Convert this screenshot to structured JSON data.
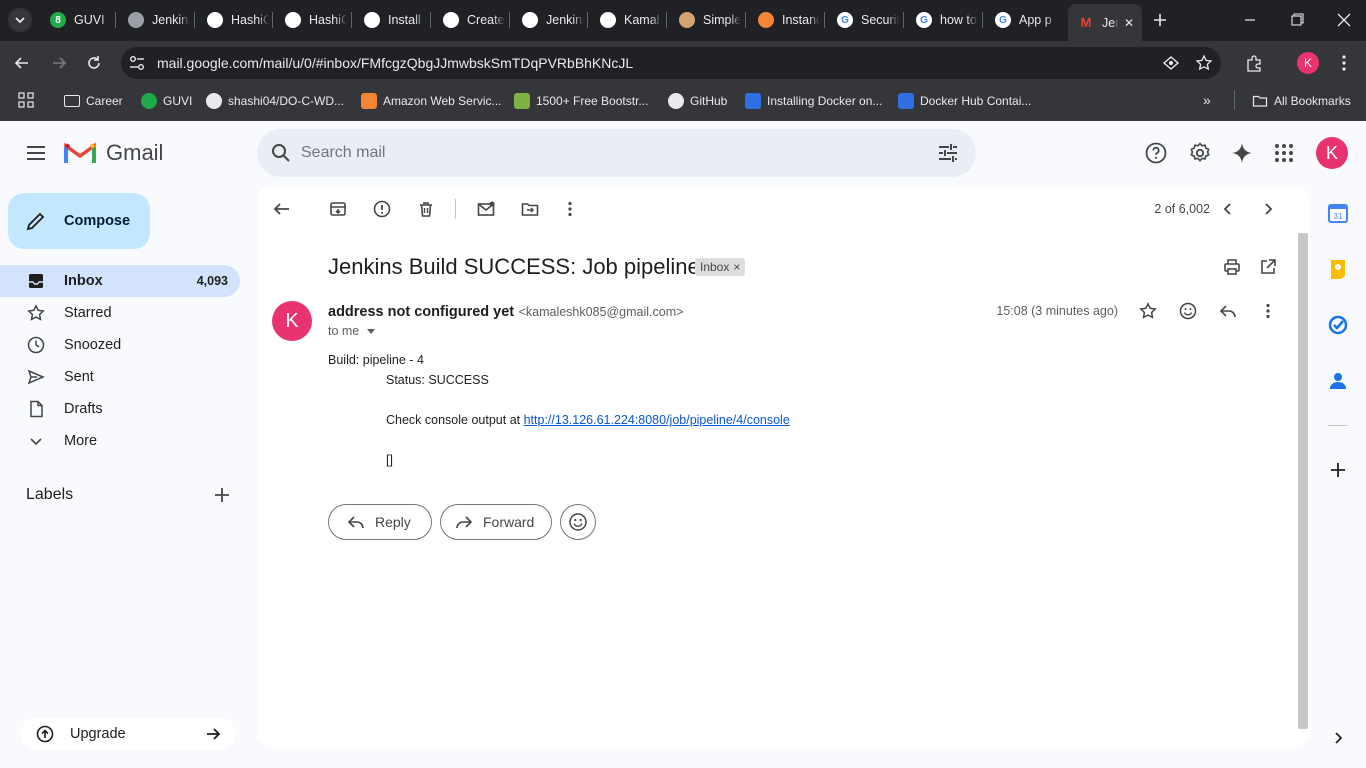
{
  "browser": {
    "tabs": [
      {
        "title": "GUVI",
        "favicon": "guvi-icon",
        "color": "#1faa4b",
        "glyph": "8"
      },
      {
        "title": "Jenkins",
        "favicon": "jenkins-icon",
        "color": "#9aa0a6",
        "glyph": ""
      },
      {
        "title": "HashiCorp",
        "favicon": "hashicorp-icon",
        "color": "#ffffff",
        "glyph": ""
      },
      {
        "title": "HashiCorp",
        "favicon": "hashicorp-icon",
        "color": "#ffffff",
        "glyph": ""
      },
      {
        "title": "Install",
        "favicon": "hashicorp-icon",
        "color": "#ffffff",
        "glyph": ""
      },
      {
        "title": "Create",
        "favicon": "hashicorp-icon",
        "color": "#ffffff",
        "glyph": ""
      },
      {
        "title": "Jenkins",
        "favicon": "github-icon",
        "color": "#ffffff",
        "glyph": ""
      },
      {
        "title": "Kamal",
        "favicon": "github-icon",
        "color": "#ffffff",
        "glyph": ""
      },
      {
        "title": "Simple",
        "favicon": "jenkins-icon",
        "color": "#d4a373",
        "glyph": ""
      },
      {
        "title": "Instance",
        "favicon": "aws-icon",
        "color": "#f58536",
        "glyph": ""
      },
      {
        "title": "Security",
        "favicon": "google-icon",
        "color": "#ffffff",
        "glyph": "G"
      },
      {
        "title": "how to",
        "favicon": "google-icon",
        "color": "#ffffff",
        "glyph": "G"
      },
      {
        "title": "App p",
        "favicon": "google-icon",
        "color": "#ffffff",
        "glyph": "G"
      },
      {
        "title": "Jenkins Build SUCCESS",
        "favicon": "gmail-icon",
        "color": "#ea4335",
        "glyph": "M",
        "active": true
      }
    ],
    "url": "mail.google.com/mail/u/0/#inbox/FMfcgzQbgJJmwbskSmTDqPVRbBhKNcJL",
    "profile_initial": "K",
    "bookmarks": [
      {
        "label": "Career",
        "icon": "folder-icon"
      },
      {
        "label": "GUVI",
        "icon": "guvi-icon"
      },
      {
        "label": "shashi04/DO-C-WD...",
        "icon": "github-icon"
      },
      {
        "label": "Amazon Web Servic...",
        "icon": "aws-icon"
      },
      {
        "label": "1500+ Free Bootstr...",
        "icon": "leaf-icon"
      },
      {
        "label": "GitHub",
        "icon": "github-icon"
      },
      {
        "label": "Installing Docker on...",
        "icon": "docker-icon"
      },
      {
        "label": "Docker Hub Contai...",
        "icon": "docker-icon"
      }
    ],
    "all_bookmarks": "All Bookmarks"
  },
  "gmail": {
    "logo_text": "Gmail",
    "search_placeholder": "Search mail",
    "compose": "Compose",
    "nav": [
      {
        "label": "Inbox",
        "count": "4,093",
        "icon": "inbox-icon",
        "active": true
      },
      {
        "label": "Starred",
        "count": "",
        "icon": "star-icon"
      },
      {
        "label": "Snoozed",
        "count": "",
        "icon": "clock-icon"
      },
      {
        "label": "Sent",
        "count": "",
        "icon": "send-icon"
      },
      {
        "label": "Drafts",
        "count": "",
        "icon": "draft-icon"
      },
      {
        "label": "More",
        "count": "",
        "icon": "chevron-down-icon"
      }
    ],
    "labels_heading": "Labels",
    "upgrade": "Upgrade",
    "avatar_initial": "K",
    "pager": "2 of 6,002"
  },
  "email": {
    "subject": "Jenkins Build SUCCESS: Job pipeline",
    "label_chip": "Inbox",
    "label_chip_close": "×",
    "sender_name": "address not configured yet",
    "sender_email": "<kamaleshk085@gmail.com>",
    "sender_initial": "K",
    "to": "to me",
    "time": "15:08 (3 minutes ago)",
    "body": {
      "line1": "Build: pipeline - 4",
      "line2": "Status: SUCCESS",
      "line3_prefix": "Check console output at ",
      "link": "http://13.126.61.224:8080/job/pipeline/4/console",
      "line4": "[]"
    },
    "reply": "Reply",
    "forward": "Forward"
  },
  "colors": {
    "accent": "#0b57d0",
    "avatar": "#e8336f",
    "compose_bg": "#c2e7ff",
    "active_nav": "#d3e3fd"
  }
}
